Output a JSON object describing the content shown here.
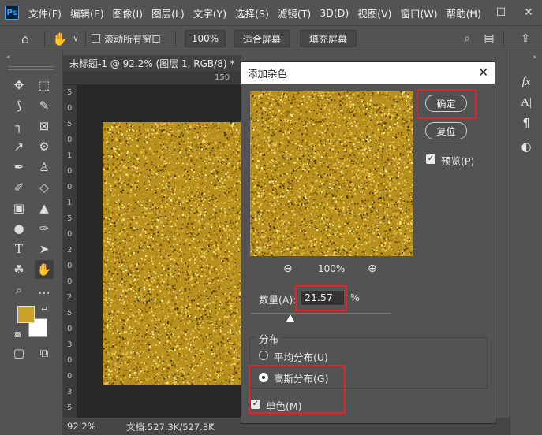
{
  "app": {
    "logo": "Ps"
  },
  "menu": [
    "文件(F)",
    "编辑(E)",
    "图像(I)",
    "图层(L)",
    "文字(Y)",
    "选择(S)",
    "滤镜(T)",
    "3D(D)",
    "视图(V)",
    "窗口(W)",
    "帮助(H)"
  ],
  "options": {
    "scroll_all_label": "滚动所有窗口",
    "zoom_label": "100%",
    "fit_screen_label": "适合屏幕",
    "fill_screen_label": "填充屏幕"
  },
  "document": {
    "tab_title": "未标题-1 @ 92.2% (图层 1, RGB/8) *",
    "ruler_top": [
      "150"
    ],
    "ruler_left": [
      "5",
      "0",
      "5",
      "0",
      "1",
      "0",
      "0",
      "1",
      "5",
      "0",
      "2",
      "0",
      "0",
      "2",
      "5",
      "0",
      "3",
      "0",
      "0",
      "3",
      "5"
    ],
    "zoom": "92.2%",
    "doc_info": "文档:527.3K/527.3K"
  },
  "dialog": {
    "title": "添加杂色",
    "ok_label": "确定",
    "reset_label": "复位",
    "preview_label": "预览(P)",
    "preview_checked": true,
    "preview_zoom": "100%",
    "amount_label": "数量(A):",
    "amount_value": "21.57",
    "amount_unit": "%",
    "distribution_label": "分布",
    "uniform_label": "平均分布(U)",
    "gaussian_label": "高斯分布(G)",
    "distribution_selected": "gaussian",
    "mono_label": "单色(M)",
    "mono_checked": true
  },
  "colors": {
    "foreground": "#c9a227",
    "background": "#ffffff",
    "gold_base": "#b8901e",
    "highlight": "#e0252b"
  }
}
